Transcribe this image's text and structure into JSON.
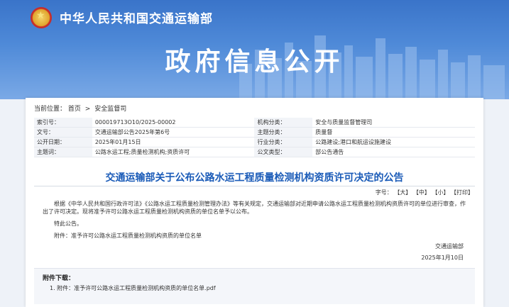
{
  "header": {
    "ministry": "中华人民共和国交通运输部",
    "section_title": "政府信息公开"
  },
  "breadcrumb": {
    "label": "当前位置：",
    "home": "首页",
    "separator": ">",
    "current": "安全监督司"
  },
  "meta": [
    {
      "k1": "索引号：",
      "v1": "000019713O10/2025-00002",
      "k2": "机构分类：",
      "v2": "安全与质量监督管理司"
    },
    {
      "k1": "文号：",
      "v1": "交通运输部公告2025年第6号",
      "k2": "主题分类：",
      "v2": "质量督"
    },
    {
      "k1": "公开日期：",
      "v1": "2025年01月15日",
      "k2": "行业分类：",
      "v2": "公路建设;港口和航运设施建设"
    },
    {
      "k1": "主题词：",
      "v1": "公路水运工程;质量检测机构;资质许可",
      "k2": "公文类型：",
      "v2": "部公告通告"
    }
  ],
  "document": {
    "title": "交通运输部关于公布公路水运工程质量检测机构资质许可决定的公告",
    "font_label": "字号：",
    "font_large": "【大】",
    "font_medium": "【中】",
    "font_small": "【小】",
    "print": "【打印】",
    "paragraph1": "根据《中华人民共和国行政许可法》《公路水运工程质量检测管理办法》等有关规定，交通运输部对近期申请公路水运工程质量检测机构资质许可的单位进行审查，作出了许可决定。现将准予许可公路水运工程质量检测机构资质的单位名单予以公布。",
    "paragraph2": "特此公告。",
    "attachment_line": "附件：准予许可公路水运工程质量检测机构资质的单位名单",
    "signature": "交通运输部",
    "date": "2025年1月10日"
  },
  "downloads": {
    "title": "附件下载：",
    "item": "1. 附件：准予许可公路水运工程质量检测机构资质的单位名单.pdf"
  }
}
